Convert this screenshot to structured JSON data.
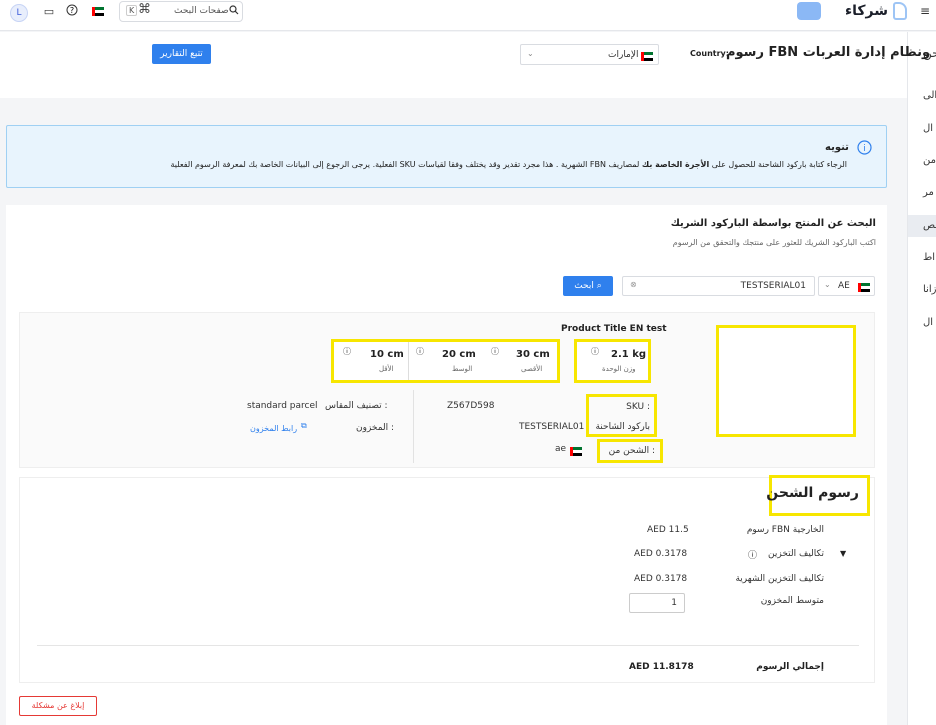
{
  "topbar": {
    "avatar_letter": "L",
    "search_placeholder": "صفحات البحث",
    "shortcut_cmd": "⌘",
    "shortcut_key": "K",
    "logo_text": "شركاء"
  },
  "header": {
    "title": "رسوم FBN ونظام إدارة العربات",
    "country_label": "Country:",
    "country_value": "الإمارات",
    "reports_button": "تتبع التقارير"
  },
  "sidebar": {
    "items": [
      "حن",
      "الى",
      "ال",
      "من",
      "مر",
      "مص",
      "اط",
      "زانا",
      "ال"
    ]
  },
  "notice": {
    "title": "تنويه",
    "text_1": "الرجاء كتابة باركود الشاحنة للحصول على",
    "text_bold": "الأجرة الخاصة بك",
    "text_2": "لمصاريف FBN الشهرية . هذا مجرد تقدير وقد يختلف وفقا لقياسات SKU الفعلية. يرجى الرجوع إلى البيانات الخاصة بك لمعرفة الرسوم الفعلية"
  },
  "search_section": {
    "title": "البحث عن المنتج بواسطة الباركود الشريك",
    "subtitle": "اكتب الباركود الشريك للعثور على منتجك والتحقق من الرسوم",
    "country_code": "AE",
    "input_value": "TESTSERIAL01",
    "search_button": "ابحث"
  },
  "product": {
    "title": "Product Title EN test",
    "weight_value": "2.1 kg",
    "weight_label": "وزن الوحدة",
    "dims": [
      {
        "value": "30 cm",
        "label": "الأقصى"
      },
      {
        "value": "20 cm",
        "label": "الوسط"
      },
      {
        "value": "10 cm",
        "label": "الأقل"
      }
    ],
    "sku_label": "SKU :",
    "sku_value": "Z567D598",
    "barcode_label": "باركود الشاحنة",
    "barcode_value": "TESTSERIAL01",
    "ship_from_label": "الشحن من :",
    "ship_from_value": "ae",
    "size_class_label": "تصنيف المقاس :",
    "size_class_value": "standard parcel",
    "inventory_label": "المخزون :",
    "inventory_link": "رابط المخزون"
  },
  "fees": {
    "title": "رسوم الشحن",
    "rows": [
      {
        "label": "رسوم FBN الخارجية",
        "value": "AED 11.5"
      },
      {
        "label": "تكاليف التخزين",
        "value": "AED 0.3178"
      },
      {
        "label": "تكاليف التخزين الشهرية",
        "value": "AED 0.3178"
      }
    ],
    "avg_inventory_label": "متوسط المخزون",
    "avg_inventory_value": "1",
    "total_label": "إجمالي الرسوم",
    "total_value": "AED 11.8178"
  },
  "report_button": "إبلاغ عن مشكلة",
  "colors": {
    "primary": "#2f80ed",
    "highlight": "#f7e600",
    "notice_bg": "#e8f4fd"
  }
}
